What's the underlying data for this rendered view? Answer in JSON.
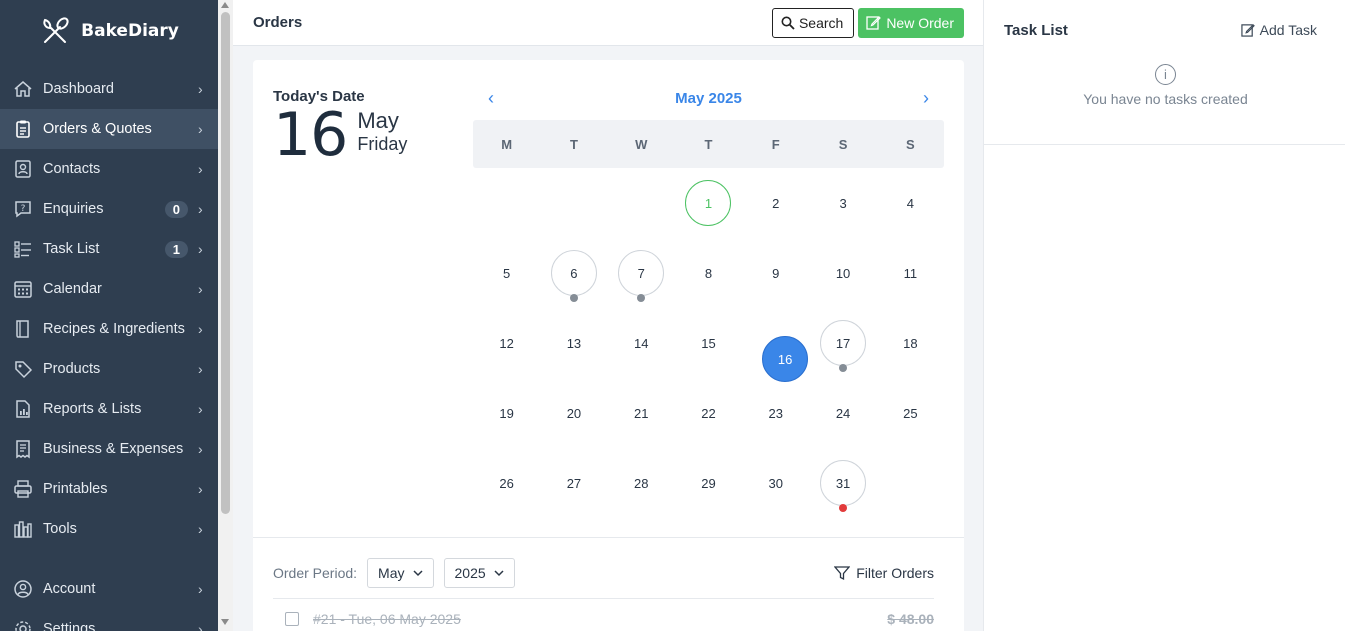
{
  "brand": {
    "name": "BakeDiary"
  },
  "sidebar": {
    "items": [
      {
        "label": "Dashboard",
        "icon": "home-icon"
      },
      {
        "label": "Orders & Quotes",
        "icon": "clipboard-icon",
        "active": true
      },
      {
        "label": "Contacts",
        "icon": "contact-card-icon"
      },
      {
        "label": "Enquiries",
        "icon": "question-bubble-icon",
        "badge": "0"
      },
      {
        "label": "Task List",
        "icon": "checklist-icon",
        "badge": "1"
      },
      {
        "label": "Calendar",
        "icon": "calendar-icon"
      },
      {
        "label": "Recipes & Ingredients",
        "icon": "book-icon"
      },
      {
        "label": "Products",
        "icon": "tag-icon"
      },
      {
        "label": "Reports & Lists",
        "icon": "report-icon"
      },
      {
        "label": "Business & Expenses",
        "icon": "receipt-icon"
      },
      {
        "label": "Printables",
        "icon": "printer-icon"
      },
      {
        "label": "Tools",
        "icon": "tools-icon"
      },
      {
        "label": "Account",
        "icon": "account-icon"
      },
      {
        "label": "Settings",
        "icon": "gear-icon"
      }
    ]
  },
  "header": {
    "title": "Orders",
    "search_label": "Search",
    "new_order_label": "New Order"
  },
  "today": {
    "label": "Today's Date",
    "day": "16",
    "month": "May",
    "weekday": "Friday"
  },
  "calendar": {
    "title": "May 2025",
    "weekdays": [
      "M",
      "T",
      "W",
      "T",
      "F",
      "S",
      "S"
    ],
    "leading_blanks": 3,
    "days": 31,
    "today": 16,
    "first_highlight": 1,
    "order_days": [
      6,
      7,
      17,
      31
    ],
    "dot_days_gray": [
      6,
      7,
      17
    ],
    "dot_days_red": [
      31
    ]
  },
  "period": {
    "label": "Order Period:",
    "month": "May",
    "year": "2025",
    "filter_label": "Filter Orders"
  },
  "orders": [
    {
      "title": "#21 - Tue, 06 May 2025",
      "amount": "$ 48.00"
    }
  ],
  "tasks": {
    "title": "Task List",
    "add_label": "Add Task",
    "empty_text": "You have no tasks created"
  },
  "colors": {
    "sidebar_bg": "#2f3e50",
    "accent_blue": "#3a86e8",
    "accent_green": "#4cc263",
    "dot_red": "#e23b3b"
  }
}
